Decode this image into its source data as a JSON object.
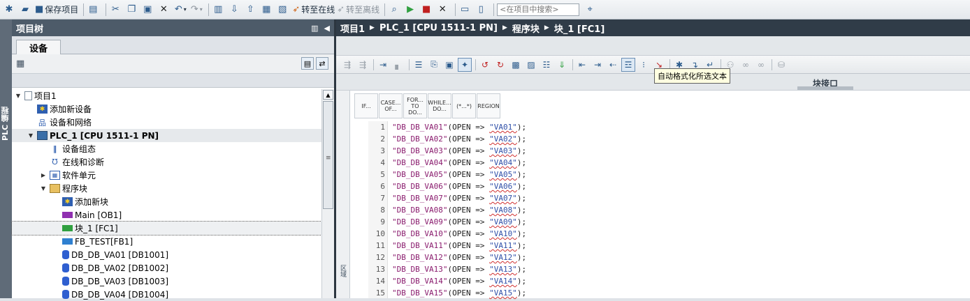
{
  "toolbar": {
    "save_label": "保存项目",
    "go_online_label": "转至在线",
    "go_offline_label": "转至离线",
    "search_placeholder": "<在项目中搜索>"
  },
  "left_strip": {
    "label": "PLC 编程"
  },
  "tree_panel": {
    "title": "项目树",
    "tab_devices": "设备",
    "items": [
      {
        "label": "项目1",
        "icon": "project-icon",
        "expander": "▼"
      },
      {
        "label": "添加新设备",
        "icon": "add-device-icon",
        "expander": ""
      },
      {
        "label": "设备和网络",
        "icon": "network-icon",
        "expander": ""
      },
      {
        "label": "PLC_1 [CPU 1511-1 PN]",
        "icon": "plc-icon",
        "expander": "▼"
      },
      {
        "label": "设备组态",
        "icon": "device-config-icon",
        "expander": ""
      },
      {
        "label": "在线和诊断",
        "icon": "online-diag-icon",
        "expander": ""
      },
      {
        "label": "软件单元",
        "icon": "software-units-icon",
        "expander": "▶"
      },
      {
        "label": "程序块",
        "icon": "program-blocks-icon",
        "expander": "▼"
      },
      {
        "label": "添加新块",
        "icon": "add-block-icon",
        "expander": ""
      },
      {
        "label": "Main [OB1]",
        "icon": "ob-icon",
        "expander": ""
      },
      {
        "label": "块_1 [FC1]",
        "icon": "fc-icon",
        "expander": ""
      },
      {
        "label": "FB_TEST[FB1]",
        "icon": "fb-icon",
        "expander": ""
      },
      {
        "label": "DB_DB_VA01 [DB1001]",
        "icon": "db-icon",
        "expander": ""
      },
      {
        "label": "DB_DB_VA02 [DB1002]",
        "icon": "db-icon",
        "expander": ""
      },
      {
        "label": "DB_DB_VA03 [DB1003]",
        "icon": "db-icon",
        "expander": ""
      },
      {
        "label": "DB_DB_VA04 [DB1004]",
        "icon": "db-icon",
        "expander": ""
      }
    ]
  },
  "breadcrumb": [
    "项目1",
    "PLC_1 [CPU 1511-1 PN]",
    "程序块",
    "块_1 [FC1]"
  ],
  "editor": {
    "interface_label": "块接口",
    "tooltip": "自动格式化所选文本",
    "side_label": "区域",
    "snippets": [
      {
        "label": "IF..."
      },
      {
        "label": "CASE... OF..."
      },
      {
        "label": "FOR... TO DO..."
      },
      {
        "label": "WHILE... DO..."
      },
      {
        "label": "(*...*)"
      },
      {
        "label": "REGION"
      }
    ],
    "code_lines": [
      {
        "num": "1",
        "db": "\"DB_DB_VA01\"",
        "mid": "(OPEN => ",
        "param": "\"VA01\"",
        "end": ");"
      },
      {
        "num": "2",
        "db": "\"DB_DB_VA02\"",
        "mid": "(OPEN => ",
        "param": "\"VA02\"",
        "end": ");"
      },
      {
        "num": "3",
        "db": "\"DB_DB_VA03\"",
        "mid": "(OPEN => ",
        "param": "\"VA03\"",
        "end": ");"
      },
      {
        "num": "4",
        "db": "\"DB_DB_VA04\"",
        "mid": "(OPEN => ",
        "param": "\"VA04\"",
        "end": ");"
      },
      {
        "num": "5",
        "db": "\"DB_DB_VA05\"",
        "mid": "(OPEN => ",
        "param": "\"VA05\"",
        "end": ");"
      },
      {
        "num": "6",
        "db": "\"DB_DB_VA06\"",
        "mid": "(OPEN => ",
        "param": "\"VA06\"",
        "end": ");"
      },
      {
        "num": "7",
        "db": "\"DB_DB_VA07\"",
        "mid": "(OPEN => ",
        "param": "\"VA07\"",
        "end": ");"
      },
      {
        "num": "8",
        "db": "\"DB_DB_VA08\"",
        "mid": "(OPEN => ",
        "param": "\"VA08\"",
        "end": ");"
      },
      {
        "num": "9",
        "db": "\"DB_DB_VA09\"",
        "mid": "(OPEN => ",
        "param": "\"VA09\"",
        "end": ");"
      },
      {
        "num": "10",
        "db": "\"DB_DB_VA10\"",
        "mid": "(OPEN => ",
        "param": "\"VA10\"",
        "end": ");"
      },
      {
        "num": "11",
        "db": "\"DB_DB_VA11\"",
        "mid": "(OPEN => ",
        "param": "\"VA11\"",
        "end": ");"
      },
      {
        "num": "12",
        "db": "\"DB_DB_VA12\"",
        "mid": "(OPEN => ",
        "param": "\"VA12\"",
        "end": ");"
      },
      {
        "num": "13",
        "db": "\"DB_DB_VA13\"",
        "mid": "(OPEN => ",
        "param": "\"VA13\"",
        "end": ");"
      },
      {
        "num": "14",
        "db": "\"DB_DB_VA14\"",
        "mid": "(OPEN => ",
        "param": "\"VA14\"",
        "end": ");"
      },
      {
        "num": "15",
        "db": "\"DB_DB_VA15\"",
        "mid": "(OPEN => ",
        "param": "\"VA15\"",
        "end": ");"
      }
    ]
  }
}
